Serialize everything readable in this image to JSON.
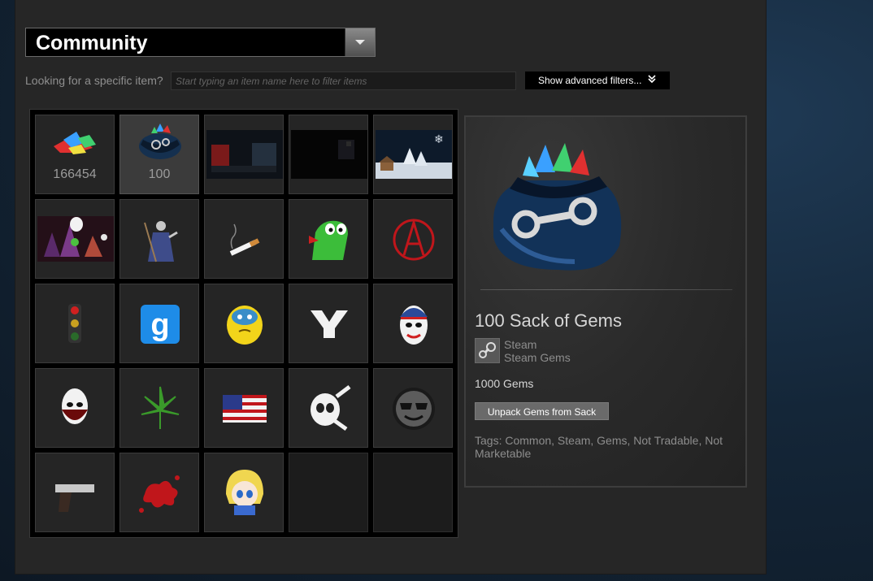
{
  "context": {
    "selected": "Community"
  },
  "filter": {
    "label": "Looking for a specific item?",
    "placeholder": "Start typing an item name here to filter items",
    "advanced_label": "Show advanced filters...",
    "advanced_icon": "double-chevron-down-icon"
  },
  "inventory": {
    "items": [
      {
        "name": "gems",
        "count": "166454"
      },
      {
        "name": "sack-of-gems",
        "count": "100",
        "selected": true
      },
      {
        "name": "background-trucks"
      },
      {
        "name": "background-dark-room"
      },
      {
        "name": "background-snowy-cabin"
      },
      {
        "name": "background-halloween"
      },
      {
        "name": "emoticon-wizard"
      },
      {
        "name": "emoticon-cigarette"
      },
      {
        "name": "emoticon-dragon"
      },
      {
        "name": "emoticon-anarchy"
      },
      {
        "name": "emoticon-traffic-light"
      },
      {
        "name": "emoticon-gmod"
      },
      {
        "name": "emoticon-yellow-blob"
      },
      {
        "name": "emoticon-y"
      },
      {
        "name": "emoticon-usa-mask"
      },
      {
        "name": "emoticon-white-mask"
      },
      {
        "name": "emoticon-leaf"
      },
      {
        "name": "emoticon-us-flag"
      },
      {
        "name": "emoticon-skull-bone"
      },
      {
        "name": "emoticon-sunglasses-face"
      },
      {
        "name": "emoticon-pistol"
      },
      {
        "name": "emoticon-blood-splat"
      },
      {
        "name": "emoticon-anime-girl"
      }
    ]
  },
  "detail": {
    "title": "100 Sack of Gems",
    "game": "Steam",
    "type": "Steam Gems",
    "description": "1000 Gems",
    "action": "Unpack Gems from Sack",
    "tags": "Tags: Common, Steam, Gems, Not Tradable, Not Marketable"
  },
  "colors": {
    "panel_bg": "#262626",
    "accent_red": "#c0161b",
    "steam_blue": "#2a5fa0"
  }
}
